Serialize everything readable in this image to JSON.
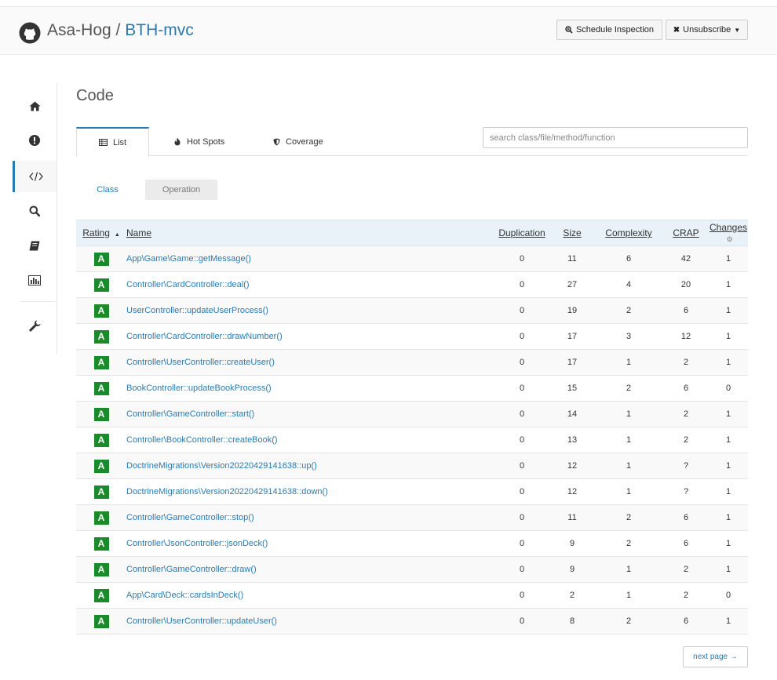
{
  "header": {
    "owner": "Asa-Hog",
    "separator": "/",
    "repo": "BTH-mvc",
    "schedule_label": "Schedule Inspection",
    "unsubscribe_label": "Unsubscribe"
  },
  "sidebar": {
    "items": [
      {
        "name": "home",
        "icon": "home-icon"
      },
      {
        "name": "issues",
        "icon": "exclamation-icon"
      },
      {
        "name": "code",
        "icon": "code-icon",
        "active": true
      },
      {
        "name": "search",
        "icon": "search-icon"
      },
      {
        "name": "book",
        "icon": "book-icon"
      },
      {
        "name": "chart",
        "icon": "bar-chart-icon"
      },
      {
        "name": "settings",
        "icon": "wrench-icon"
      }
    ]
  },
  "page": {
    "title": "Code"
  },
  "tabs": {
    "list": "List",
    "hotspots": "Hot Spots",
    "coverage": "Coverage"
  },
  "search": {
    "placeholder": "search class/file/method/function"
  },
  "subtabs": {
    "class": "Class",
    "operation": "Operation"
  },
  "table": {
    "headers": {
      "rating": "Rating",
      "name": "Name",
      "duplication": "Duplication",
      "size": "Size",
      "complexity": "Complexity",
      "crap": "CRAP",
      "changes": "Changes"
    },
    "rows": [
      {
        "rating": "A",
        "name": "App\\Game\\Game::getMessage()",
        "duplication": "0",
        "size": "11",
        "complexity": "6",
        "crap": "42",
        "changes": "1"
      },
      {
        "rating": "A",
        "name": "Controller\\CardController::deal()",
        "duplication": "0",
        "size": "27",
        "complexity": "4",
        "crap": "20",
        "changes": "1"
      },
      {
        "rating": "A",
        "name": "UserController::updateUserProcess()",
        "duplication": "0",
        "size": "19",
        "complexity": "2",
        "crap": "6",
        "changes": "1"
      },
      {
        "rating": "A",
        "name": "Controller\\CardController::drawNumber()",
        "duplication": "0",
        "size": "17",
        "complexity": "3",
        "crap": "12",
        "changes": "1"
      },
      {
        "rating": "A",
        "name": "Controller\\UserController::createUser()",
        "duplication": "0",
        "size": "17",
        "complexity": "1",
        "crap": "2",
        "changes": "1"
      },
      {
        "rating": "A",
        "name": "BookController::updateBookProcess()",
        "duplication": "0",
        "size": "15",
        "complexity": "2",
        "crap": "6",
        "changes": "0"
      },
      {
        "rating": "A",
        "name": "Controller\\GameController::start()",
        "duplication": "0",
        "size": "14",
        "complexity": "1",
        "crap": "2",
        "changes": "1"
      },
      {
        "rating": "A",
        "name": "Controller\\BookController::createBook()",
        "duplication": "0",
        "size": "13",
        "complexity": "1",
        "crap": "2",
        "changes": "1"
      },
      {
        "rating": "A",
        "name": "DoctrineMigrations\\Version20220429141638::up()",
        "duplication": "0",
        "size": "12",
        "complexity": "1",
        "crap": "?",
        "changes": "1"
      },
      {
        "rating": "A",
        "name": "DoctrineMigrations\\Version20220429141638::down()",
        "duplication": "0",
        "size": "12",
        "complexity": "1",
        "crap": "?",
        "changes": "1"
      },
      {
        "rating": "A",
        "name": "Controller\\GameController::stop()",
        "duplication": "0",
        "size": "11",
        "complexity": "2",
        "crap": "6",
        "changes": "1"
      },
      {
        "rating": "A",
        "name": "Controller\\JsonController::jsonDeck()",
        "duplication": "0",
        "size": "9",
        "complexity": "2",
        "crap": "6",
        "changes": "1"
      },
      {
        "rating": "A",
        "name": "Controller\\GameController::draw()",
        "duplication": "0",
        "size": "9",
        "complexity": "1",
        "crap": "2",
        "changes": "1"
      },
      {
        "rating": "A",
        "name": "App\\Card\\Deck::cardsInDeck()",
        "duplication": "0",
        "size": "2",
        "complexity": "1",
        "crap": "2",
        "changes": "0"
      },
      {
        "rating": "A",
        "name": "Controller\\UserController::updateUser()",
        "duplication": "0",
        "size": "8",
        "complexity": "2",
        "crap": "6",
        "changes": "1"
      }
    ]
  },
  "pagination": {
    "next_label": "next page →"
  },
  "colors": {
    "link": "#2a7ab0",
    "rating_a": "#1a8a2a",
    "header_bg": "#e8f2f8"
  }
}
